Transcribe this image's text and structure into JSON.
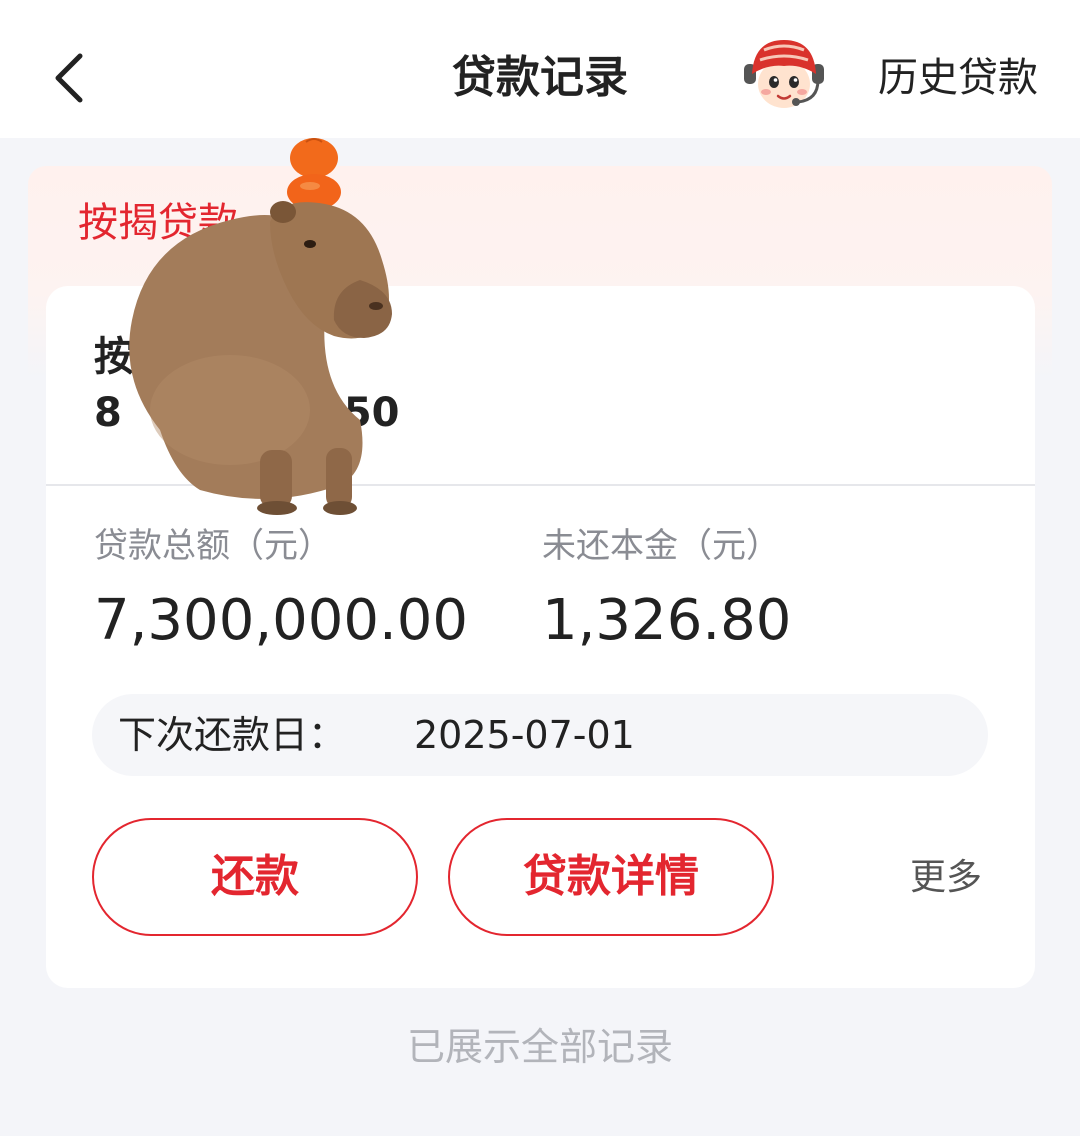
{
  "header": {
    "title": "贷款记录",
    "history_label": "历史贷款",
    "mascot_icon": "mascot-avatar-icon",
    "back_icon": "chevron-left-icon"
  },
  "loan": {
    "section_title": "按揭贷款",
    "product_name": "按",
    "account_number": "8",
    "account_number_tail": "50",
    "total_label": "贷款总额（元）",
    "total_value": "7,300,000.00",
    "principal_label": "未还本金（元）",
    "principal_value": "1,326.80",
    "due_label": "下次还款日：",
    "due_date": "2025-07-01",
    "repay_button": "还款",
    "detail_button": "贷款详情",
    "more_label": "更多"
  },
  "footer": {
    "note": "已展示全部记录"
  },
  "sticker": {
    "icon": "capybara-sticker-icon"
  },
  "colors": {
    "accent": "#e3262f",
    "text_primary": "#222222",
    "text_secondary": "#8a8c93",
    "background": "#f4f5f9"
  }
}
